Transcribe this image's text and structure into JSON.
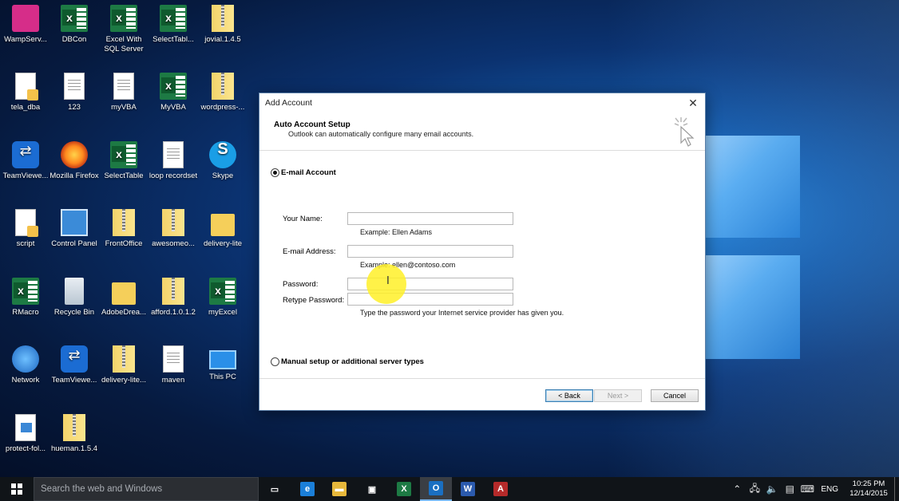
{
  "desktop_icons": [
    {
      "label": "WampServ...",
      "icon": "wamp-icon"
    },
    {
      "label": "DBCon",
      "icon": "excel-icon"
    },
    {
      "label": "Excel With SQL Server",
      "icon": "excel-icon"
    },
    {
      "label": "SelectTabl...",
      "icon": "excel-icon"
    },
    {
      "label": "jovial.1.4.5",
      "icon": "zip-icon"
    },
    {
      "label": "tela_dba",
      "icon": "script-icon"
    },
    {
      "label": "123",
      "icon": "document-icon"
    },
    {
      "label": "myVBA",
      "icon": "document-icon"
    },
    {
      "label": "MyVBA",
      "icon": "excel-icon"
    },
    {
      "label": "wordpress-...",
      "icon": "zip-icon"
    },
    {
      "label": "TeamViewe...",
      "icon": "teamviewer-icon"
    },
    {
      "label": "Mozilla Firefox",
      "icon": "firefox-icon"
    },
    {
      "label": "SelectTable",
      "icon": "excel-icon"
    },
    {
      "label": "loop recordset",
      "icon": "document-icon"
    },
    {
      "label": "Skype",
      "icon": "skype-icon"
    },
    {
      "label": "script",
      "icon": "script-icon"
    },
    {
      "label": "Control Panel",
      "icon": "control-panel-icon"
    },
    {
      "label": "FrontOffice",
      "icon": "zip-icon"
    },
    {
      "label": "awesomeo...",
      "icon": "zip-icon"
    },
    {
      "label": "delivery-lite",
      "icon": "folder-icon"
    },
    {
      "label": "RMacro",
      "icon": "excel-icon"
    },
    {
      "label": "Recycle Bin",
      "icon": "recycle-bin-icon"
    },
    {
      "label": "AdobeDrea...",
      "icon": "folder-icon"
    },
    {
      "label": "afford.1.0.1.2",
      "icon": "zip-icon"
    },
    {
      "label": "myExcel",
      "icon": "excel-icon"
    },
    {
      "label": "Network",
      "icon": "network-icon"
    },
    {
      "label": "TeamViewe...",
      "icon": "teamviewer-icon"
    },
    {
      "label": "delivery-lite...",
      "icon": "zip-icon"
    },
    {
      "label": "maven",
      "icon": "document-icon"
    },
    {
      "label": "This PC",
      "icon": "this-pc-icon"
    },
    {
      "label": "protect-fol...",
      "icon": "picture-file-icon"
    },
    {
      "label": "hueman.1.5.4",
      "icon": "zip-icon"
    }
  ],
  "dialog": {
    "title": "Add Account",
    "close_glyph": "✕",
    "header_title": "Auto Account Setup",
    "header_subtitle": "Outlook can automatically configure many email accounts.",
    "email_option_label": "E-mail Account",
    "fields": {
      "name_label": "Your Name:",
      "name_value": "",
      "name_hint": "Example: Ellen Adams",
      "email_label": "E-mail Address:",
      "email_value": "",
      "email_hint": "Example: ellen@contoso.com",
      "password_label": "Password:",
      "password_value": "",
      "retype_label": "Retype Password:",
      "retype_value": "",
      "password_hint": "Type the password your Internet service provider has given you."
    },
    "manual_option_label": "Manual setup or additional server types",
    "buttons": {
      "back": "< Back",
      "next": "Next >",
      "cancel": "Cancel"
    }
  },
  "taskbar": {
    "search_placeholder": "Search the web and Windows",
    "apps": [
      {
        "name": "task-view",
        "glyph": "▭",
        "color": "#101418"
      },
      {
        "name": "edge",
        "glyph": "e",
        "color": "#1b7fd8"
      },
      {
        "name": "file-explorer",
        "glyph": "▬",
        "color": "#e7b83b"
      },
      {
        "name": "store",
        "glyph": "▣",
        "color": "#101418"
      },
      {
        "name": "excel",
        "glyph": "X",
        "color": "#1d7a44"
      },
      {
        "name": "outlook",
        "glyph": "O",
        "color": "#1a6fc2"
      },
      {
        "name": "word",
        "glyph": "W",
        "color": "#2b5aad"
      },
      {
        "name": "access",
        "glyph": "A",
        "color": "#b52a2a"
      }
    ],
    "tray_language": "ENG",
    "clock_time": "10:25 PM",
    "clock_date": "12/14/2015"
  }
}
